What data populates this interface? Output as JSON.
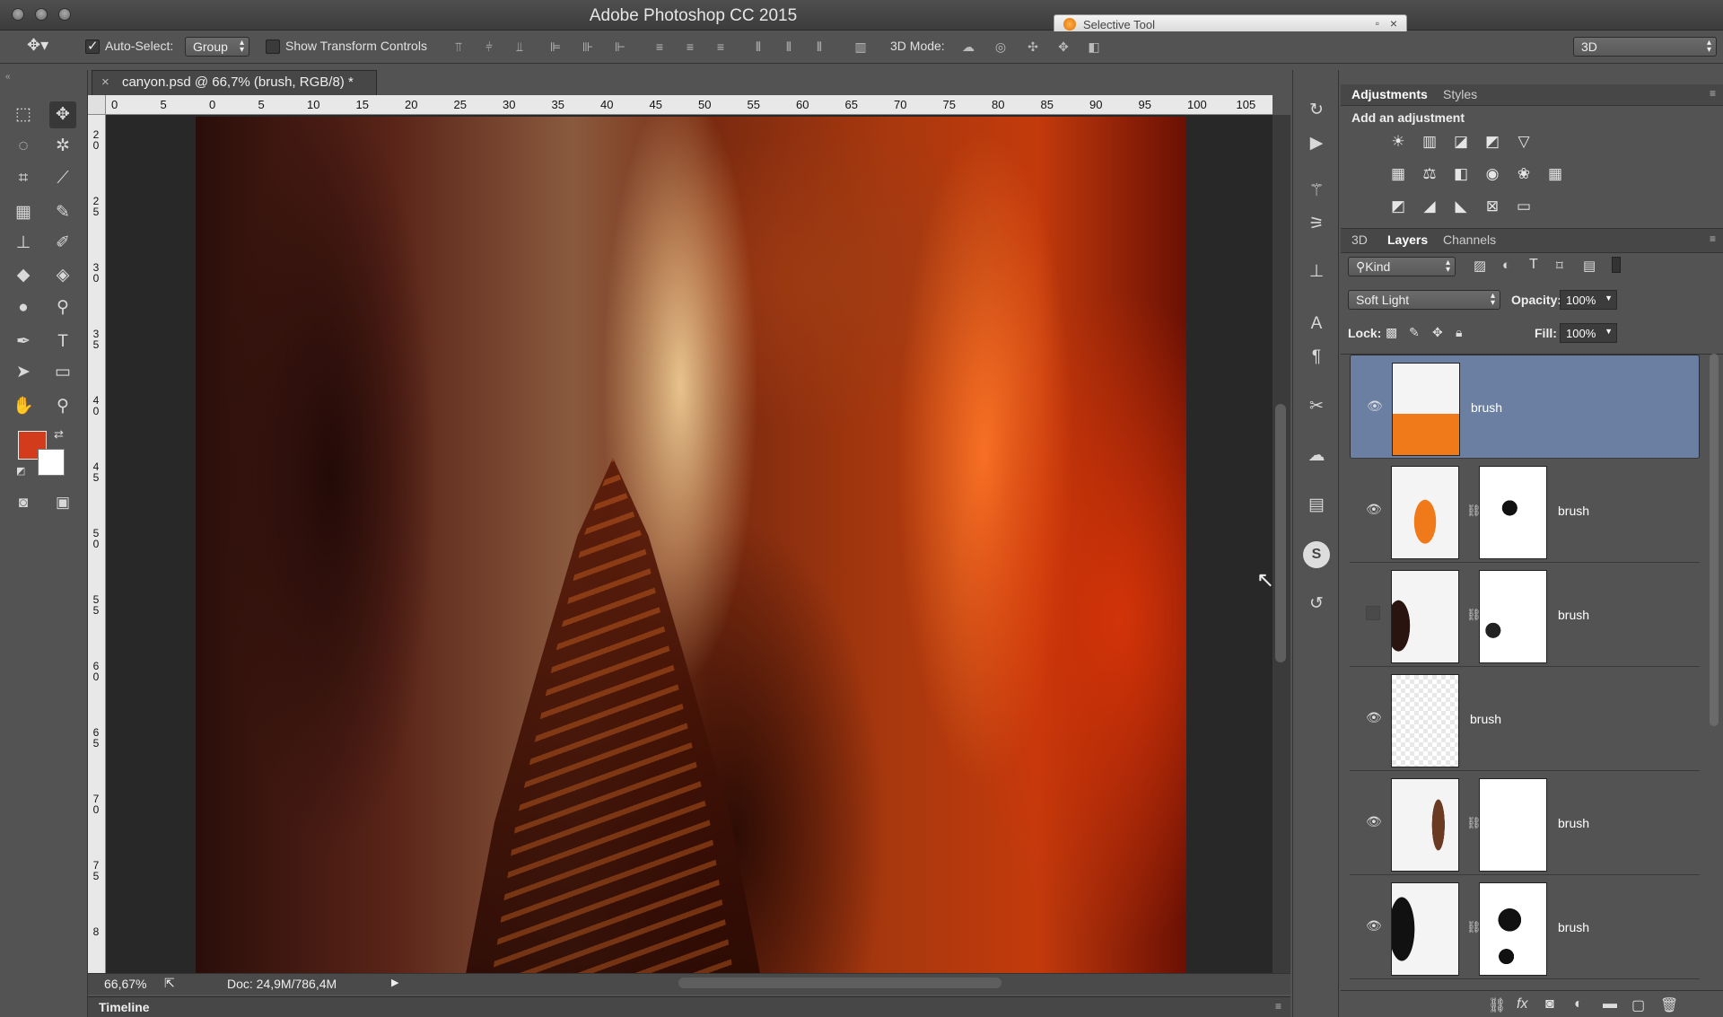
{
  "app": {
    "title": "Adobe Photoshop CC 2015",
    "floating_window_title": "Selective Tool"
  },
  "options_bar": {
    "auto_select_label": "Auto-Select:",
    "auto_select_value": "Group",
    "show_transform_label": "Show Transform Controls",
    "three_d_mode_label": "3D Mode:",
    "workspace_value": "3D"
  },
  "document": {
    "tab_title": "canyon.psd @ 66,7% (brush, RGB/8) *",
    "zoom": "66,67%",
    "doc_size": "Doc: 24,9M/786,4M",
    "timeline_label": "Timeline",
    "hruler_labels": [
      "0",
      "5",
      "0",
      "5",
      "10",
      "15",
      "20",
      "25",
      "30",
      "35",
      "40",
      "45",
      "50",
      "55",
      "60",
      "65",
      "70",
      "75",
      "80",
      "85",
      "90",
      "95",
      "100",
      "105"
    ],
    "vruler_labels": [
      "2\n0",
      "2\n5",
      "3\n0",
      "3\n5",
      "4\n0",
      "4\n5",
      "5\n0",
      "5\n5",
      "6\n0",
      "6\n5",
      "7\n0",
      "7\n5",
      "8"
    ]
  },
  "panels": {
    "adjustments_tab": "Adjustments",
    "styles_tab": "Styles",
    "add_adjustment": "Add an adjustment",
    "tab_3d": "3D",
    "layers_tab": "Layers",
    "channels_tab": "Channels",
    "filter_kind": "Kind",
    "blend_mode": "Soft Light",
    "opacity_label": "Opacity:",
    "opacity_value": "100%",
    "lock_label": "Lock:",
    "fill_label": "Fill:",
    "fill_value": "100%"
  },
  "layers": [
    {
      "name": "brush",
      "visible": true,
      "selected": true,
      "has_mask": false
    },
    {
      "name": "brush",
      "visible": true,
      "selected": false,
      "has_mask": true
    },
    {
      "name": "brush",
      "visible": false,
      "selected": false,
      "has_mask": true
    },
    {
      "name": "brush",
      "visible": true,
      "selected": false,
      "has_mask": false
    },
    {
      "name": "brush",
      "visible": true,
      "selected": false,
      "has_mask": true
    },
    {
      "name": "brush",
      "visible": true,
      "selected": false,
      "has_mask": true
    }
  ],
  "colors": {
    "foreground": "#d23b1b",
    "background": "#ffffff",
    "selection": "#6a7fa1"
  }
}
